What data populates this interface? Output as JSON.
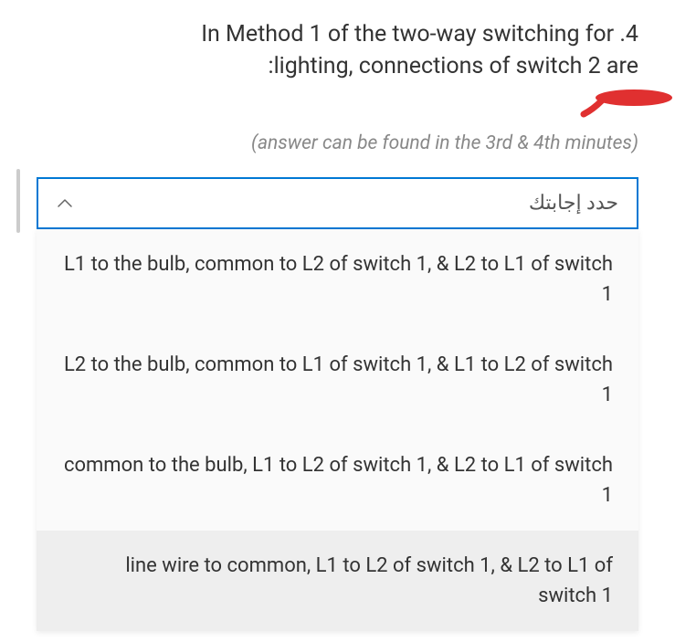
{
  "question": {
    "number": ".4",
    "line1": "In Method 1 of the two-way switching for",
    "line2": ":lighting, connections of switch 2 are",
    "hint": "(answer can be found in the 3rd & 4th minutes)"
  },
  "dropdown": {
    "placeholder": "حدد إجابتك",
    "options": [
      "L1 to the bulb, common to L2 of switch 1, & L2 to L1 of switch 1",
      "L2 to the bulb, common to L1 of switch 1, & L1 to L2 of switch 1",
      "common to the bulb, L1 to L2 of switch 1, & L2 to L1 of switch 1",
      "line wire to common, L1 to L2 of switch 1, & L2 to L1 of switch 1"
    ]
  }
}
